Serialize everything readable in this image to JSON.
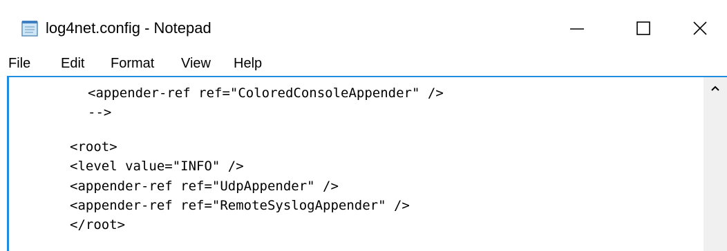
{
  "window": {
    "title": "log4net.config - Notepad",
    "app_icon": "notepad-icon",
    "controls": {
      "minimize_icon": "minimize-icon",
      "maximize_icon": "maximize-icon",
      "close_icon": "close-icon"
    }
  },
  "menu": {
    "items": [
      {
        "label": "File"
      },
      {
        "label": "Edit"
      },
      {
        "label": "Format"
      },
      {
        "label": "View"
      },
      {
        "label": "Help"
      }
    ]
  },
  "editor": {
    "lines": [
      "<appender-ref ref=\"ColoredConsoleAppender\" />",
      "-->",
      "<root>",
      "<level value=\"INFO\" />",
      "<appender-ref ref=\"UdpAppender\" />",
      "<appender-ref ref=\"RemoteSyslogAppender\" />",
      "</root>"
    ],
    "scrollbar_icon": "scroll-up-arrow-icon"
  },
  "colors": {
    "accent_border": "#1c8de1",
    "text": "#000000",
    "scrollbar": "#f0f0f0"
  }
}
